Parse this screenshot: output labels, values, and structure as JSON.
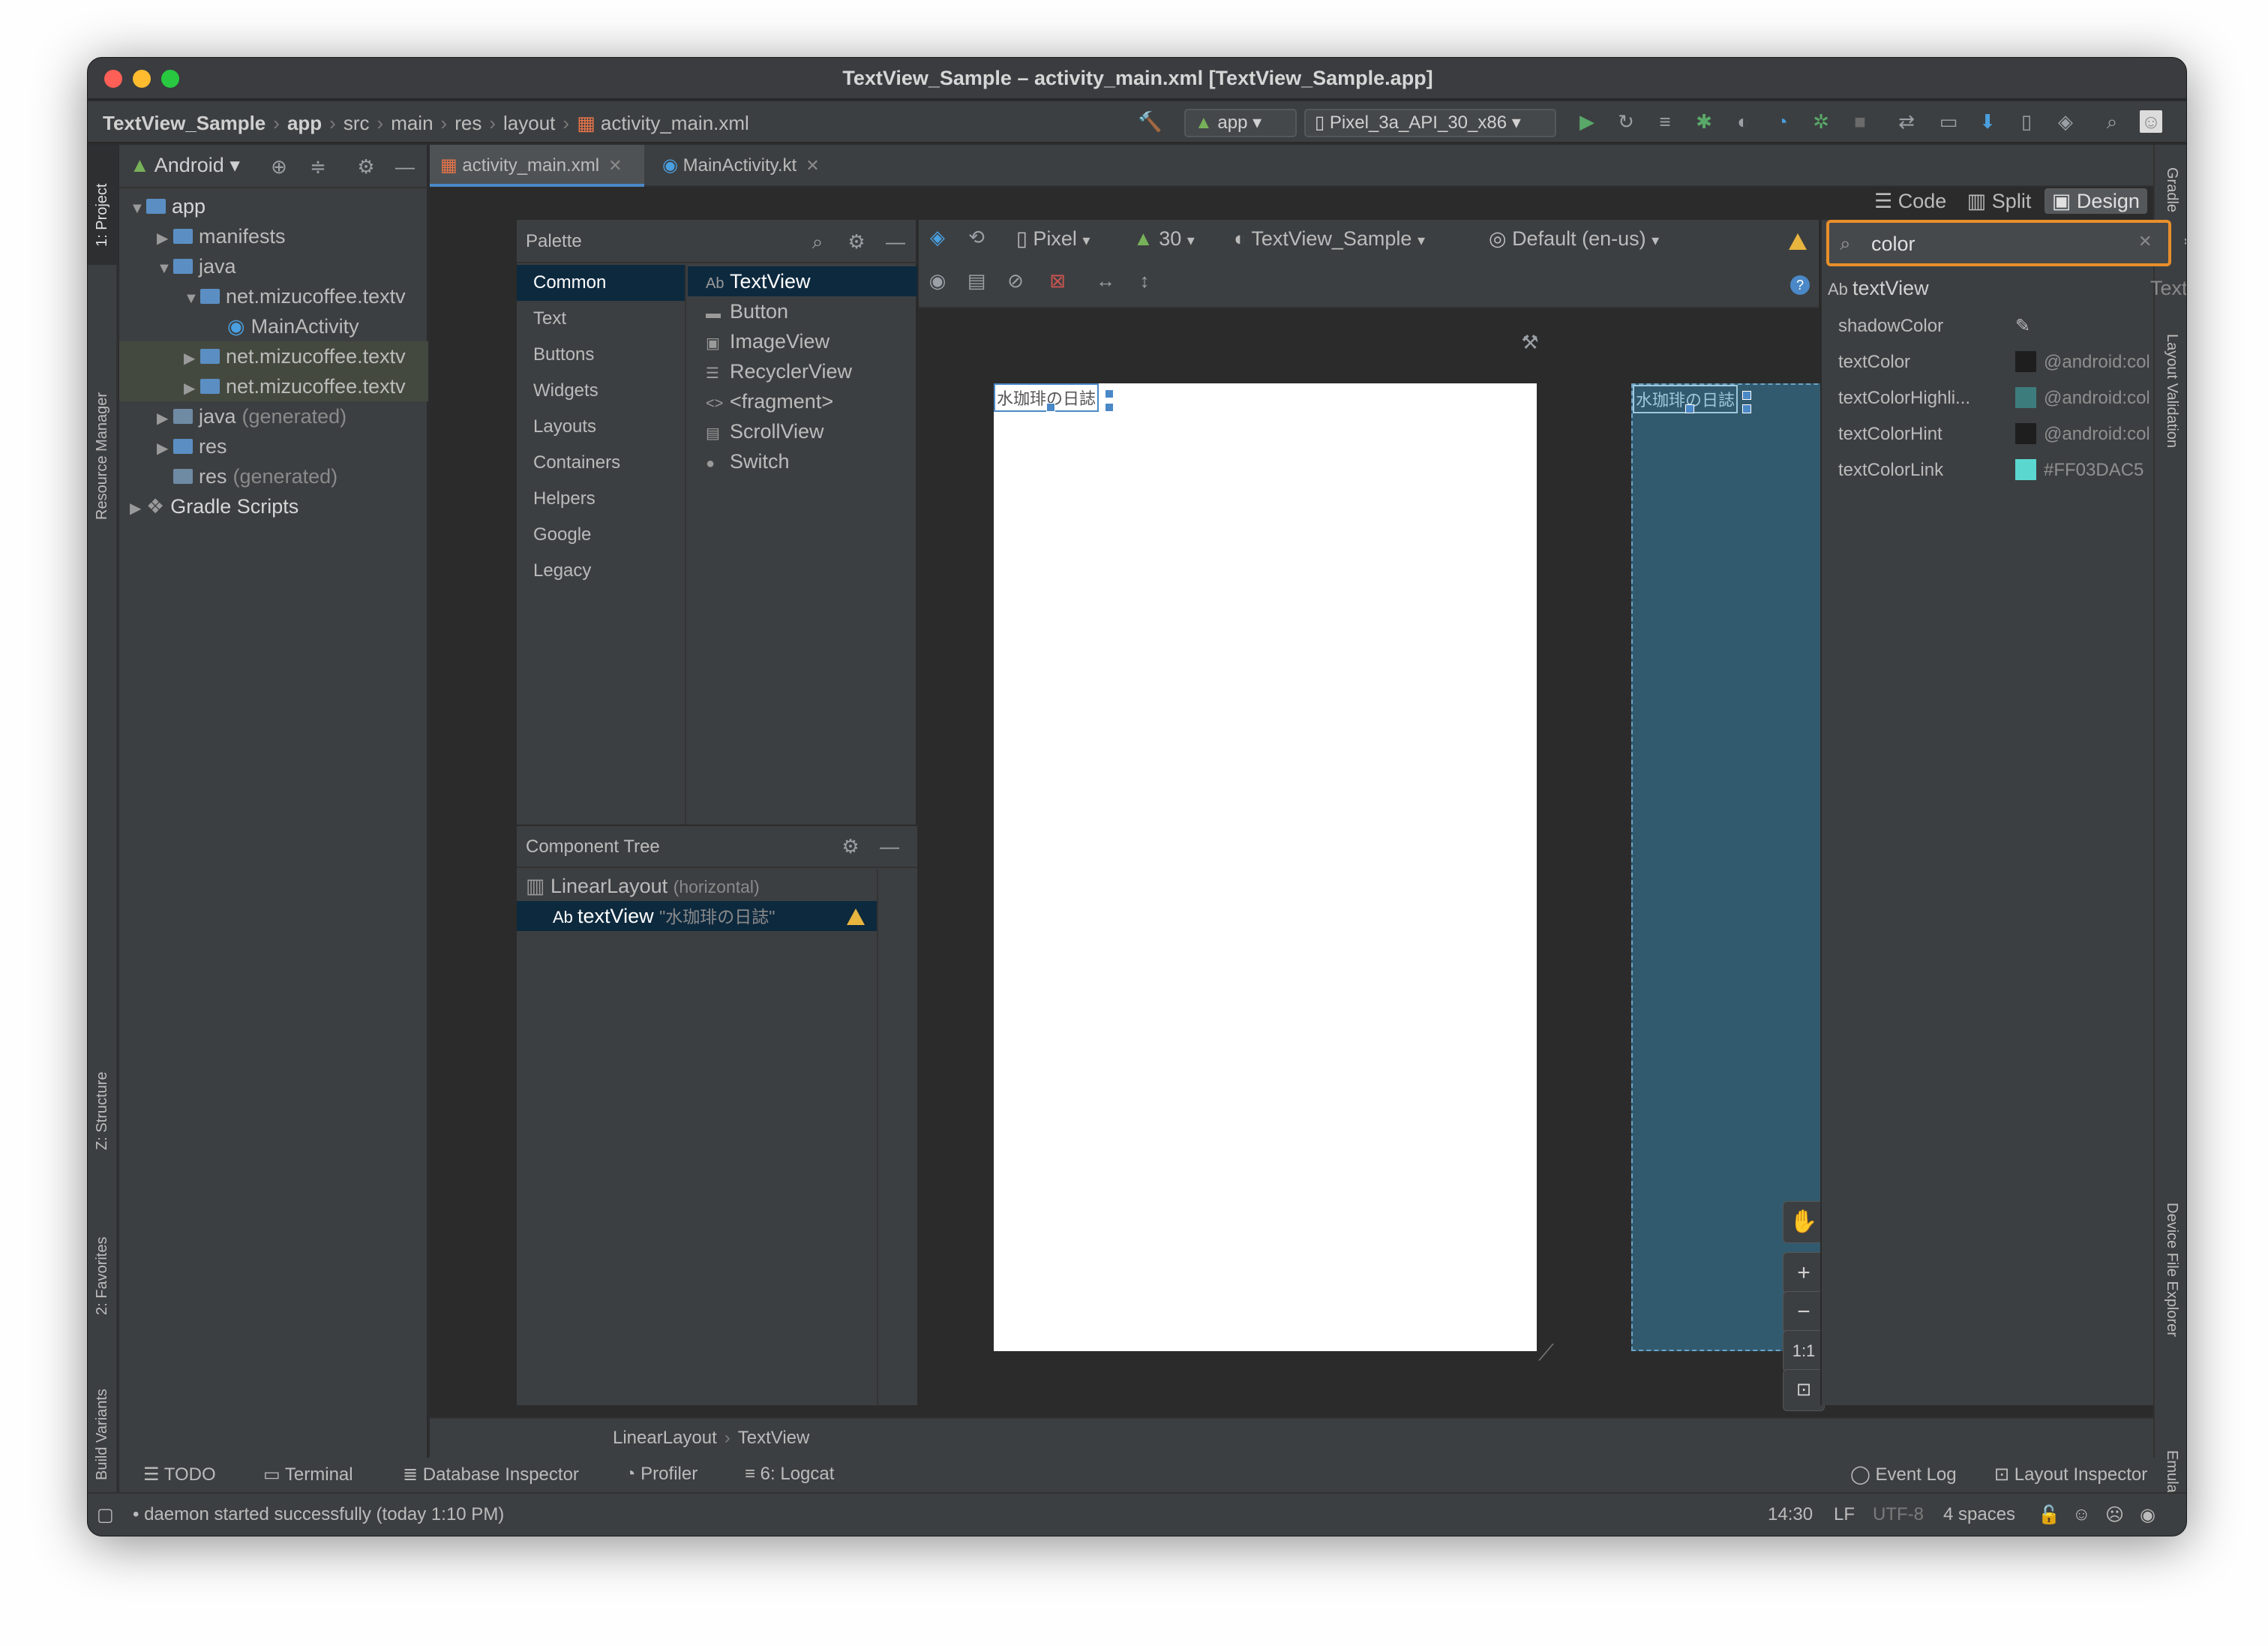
{
  "window": {
    "title": "TextView_Sample – activity_main.xml [TextView_Sample.app]"
  },
  "breadcrumb": {
    "items": [
      "TextView_Sample",
      "app",
      "src",
      "main",
      "res",
      "layout",
      "activity_main.xml"
    ]
  },
  "toolbar": {
    "run_config": "app",
    "device": "Pixel_3a_API_30_x86"
  },
  "left_tools": {
    "project": "1: Project",
    "resource_manager": "Resource Manager",
    "structure": "Z: Structure",
    "favorites": "2: Favorites",
    "build_variants": "Build Variants"
  },
  "right_tools": {
    "gradle": "Gradle",
    "layout_validation": "Layout Validation",
    "device_file_explorer": "Device File Explorer",
    "emulator": "Emulator"
  },
  "project": {
    "view_mode": "Android",
    "tree": [
      {
        "label": "app",
        "suffix": "",
        "depth": 0,
        "arrow": "down"
      },
      {
        "label": "manifests",
        "suffix": "",
        "depth": 1,
        "arrow": "right"
      },
      {
        "label": "java",
        "suffix": "",
        "depth": 1,
        "arrow": "down"
      },
      {
        "label": "net.mizucoffee.textv",
        "suffix": "",
        "depth": 2,
        "arrow": "down"
      },
      {
        "label": "MainActivity",
        "suffix": "",
        "depth": 3,
        "arrow": "none"
      },
      {
        "label": "net.mizucoffee.textv",
        "suffix": "",
        "depth": 2,
        "arrow": "right"
      },
      {
        "label": "net.mizucoffee.textv",
        "suffix": "",
        "depth": 2,
        "arrow": "right"
      },
      {
        "label": "java",
        "suffix": "(generated)",
        "depth": 1,
        "arrow": "right"
      },
      {
        "label": "res",
        "suffix": "",
        "depth": 1,
        "arrow": "right"
      },
      {
        "label": "res",
        "suffix": "(generated)",
        "depth": 1,
        "arrow": "none"
      },
      {
        "label": "Gradle Scripts",
        "suffix": "",
        "depth": 0,
        "arrow": "right"
      }
    ]
  },
  "tabs": [
    {
      "label": "activity_main.xml"
    },
    {
      "label": "MainActivity.kt"
    }
  ],
  "view_modes": {
    "code": "Code",
    "split": "Split",
    "design": "Design"
  },
  "palette": {
    "title": "Palette",
    "categories": [
      "Common",
      "Text",
      "Buttons",
      "Widgets",
      "Layouts",
      "Containers",
      "Helpers",
      "Google",
      "Legacy"
    ],
    "items": [
      {
        "icon": "Ab",
        "label": "TextView"
      },
      {
        "icon": "▬",
        "label": "Button"
      },
      {
        "icon": "▣",
        "label": "ImageView"
      },
      {
        "icon": "☰",
        "label": "RecyclerView"
      },
      {
        "icon": "<>",
        "label": "<fragment>"
      },
      {
        "icon": "▤",
        "label": "ScrollView"
      },
      {
        "icon": "●",
        "label": "Switch"
      }
    ]
  },
  "design_toolbar": {
    "device": "Pixel",
    "api": "30",
    "theme": "TextView_Sample",
    "locale": "Default (en-us)"
  },
  "component_tree": {
    "title": "Component Tree",
    "rows": [
      {
        "label": "LinearLayout",
        "detail": "(horizontal)"
      },
      {
        "label": "textView",
        "detail": "\"水珈琲の日誌\""
      }
    ]
  },
  "preview": {
    "text": "水珈琲の日誌"
  },
  "zoom": {
    "fit": "1:1"
  },
  "attributes": {
    "search_value": "color",
    "selected_id": "textView",
    "selected_class": "TextView",
    "rows": [
      {
        "name": "shadowColor",
        "value": "",
        "swatch": ""
      },
      {
        "name": "textColor",
        "value": "@android:color/sec",
        "swatch": "#1e1e1e"
      },
      {
        "name": "textColorHighli...",
        "value": "@android:color/hig",
        "swatch": "#3d7c7c"
      },
      {
        "name": "textColorHint",
        "value": "@android:color/hin",
        "swatch": "#1e1e1e"
      },
      {
        "name": "textColorLink",
        "value": "#FF03DAC5",
        "swatch": "#5ad8d0"
      }
    ]
  },
  "status_breadcrumb": [
    "LinearLayout",
    "TextView"
  ],
  "bottom_tools": {
    "left": [
      "TODO",
      "Terminal",
      "Database Inspector",
      "Profiler",
      "6: Logcat"
    ],
    "right": [
      "Event Log",
      "Layout Inspector"
    ]
  },
  "statusbar": {
    "message": "daemon started successfully (today 1:10 PM)",
    "position": "14:30",
    "line_sep": "LF",
    "encoding": "UTF-8",
    "indent": "4 spaces"
  }
}
